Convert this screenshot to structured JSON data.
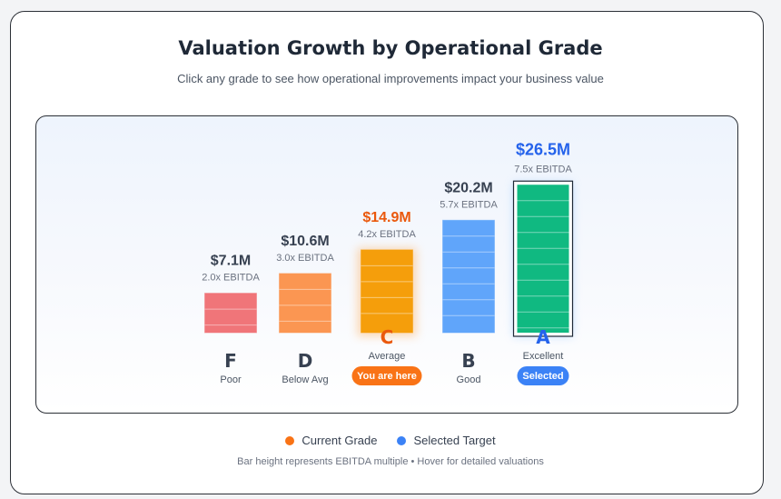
{
  "header": {
    "title": "Valuation Growth by Operational Grade",
    "subtitle": "Click any grade to see how operational improvements impact your business value"
  },
  "chart_data": {
    "type": "bar",
    "categories": [
      "F",
      "D",
      "C",
      "B",
      "A"
    ],
    "grade_labels": [
      "Poor",
      "Below Avg",
      "Average",
      "Good",
      "Excellent"
    ],
    "values": [
      2.0,
      3.0,
      4.2,
      5.7,
      7.5
    ],
    "value_unit": "x EBITDA",
    "value_labels": [
      "$7.1M",
      "$10.6M",
      "$14.9M",
      "$20.2M",
      "$26.5M"
    ],
    "multiple_labels": [
      "2.0x EBITDA",
      "3.0x EBITDA",
      "4.2x EBITDA",
      "5.7x EBITDA",
      "7.5x EBITDA"
    ],
    "bar_colors": [
      "#f07579",
      "#fb9652",
      "#f59e0b",
      "#60a5fa",
      "#10b981"
    ],
    "current_grade": "C",
    "selected_grade": "A",
    "current_badge": "You are here",
    "selected_badge": "Selected"
  },
  "legend": {
    "current_label": "Current Grade",
    "selected_label": "Selected Target",
    "current_color": "#f97316",
    "selected_color": "#3b82f6"
  },
  "footnote": "Bar height represents EBITDA multiple • Hover for detailed valuations"
}
